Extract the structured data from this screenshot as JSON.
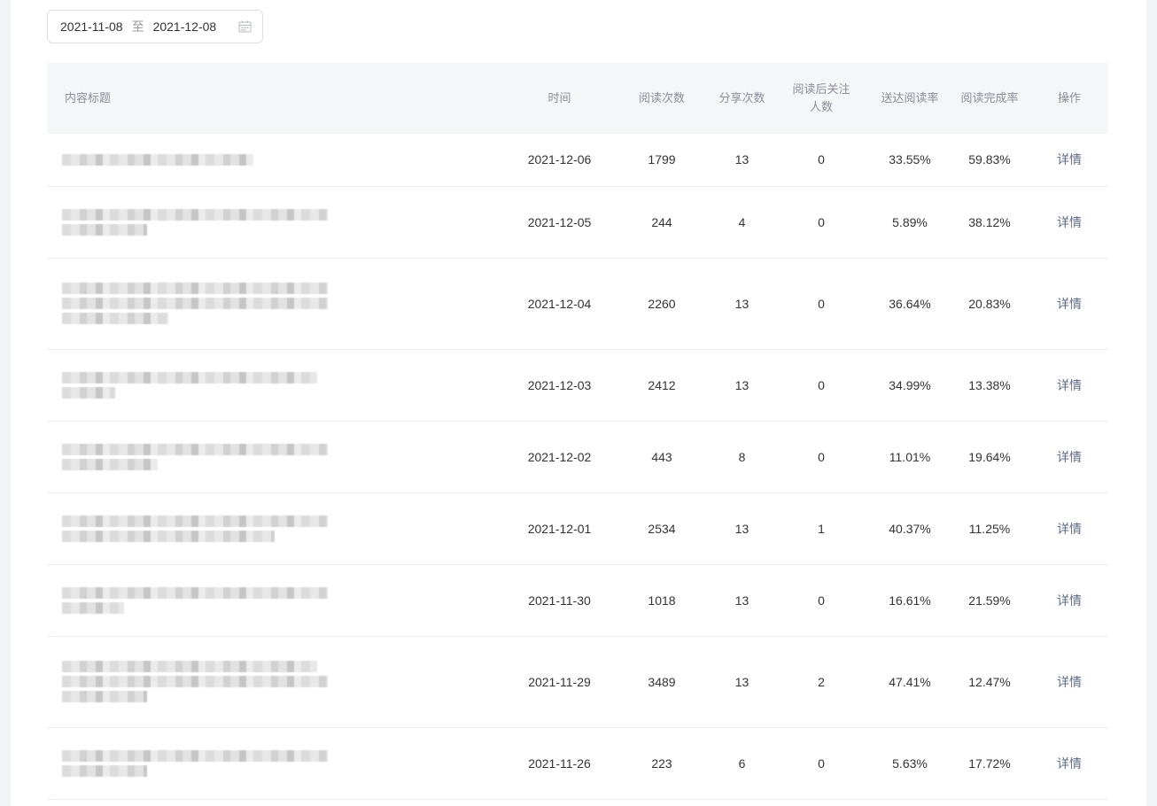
{
  "date_range": {
    "start": "2021-11-08",
    "separator": "至",
    "end": "2021-12-08",
    "icon": "calendar-icon"
  },
  "table": {
    "headers": {
      "title": "内容标题",
      "date": "时间",
      "reads": "阅读次数",
      "shares": "分享次数",
      "follows_line1": "阅读后关注",
      "follows_line2": "人数",
      "delivery_read_rate": "送达阅读率",
      "completion_rate": "阅读完成率",
      "action": "操作"
    },
    "rows": [
      {
        "date": "2021-12-06",
        "reads": "1799",
        "shares": "13",
        "follows": "0",
        "delivery_read_rate": "33.55%",
        "completion_rate": "59.83%",
        "action": "详情"
      },
      {
        "date": "2021-12-05",
        "reads": "244",
        "shares": "4",
        "follows": "0",
        "delivery_read_rate": "5.89%",
        "completion_rate": "38.12%",
        "action": "详情"
      },
      {
        "date": "2021-12-04",
        "reads": "2260",
        "shares": "13",
        "follows": "0",
        "delivery_read_rate": "36.64%",
        "completion_rate": "20.83%",
        "action": "详情"
      },
      {
        "date": "2021-12-03",
        "reads": "2412",
        "shares": "13",
        "follows": "0",
        "delivery_read_rate": "34.99%",
        "completion_rate": "13.38%",
        "action": "详情"
      },
      {
        "date": "2021-12-02",
        "reads": "443",
        "shares": "8",
        "follows": "0",
        "delivery_read_rate": "11.01%",
        "completion_rate": "19.64%",
        "action": "详情"
      },
      {
        "date": "2021-12-01",
        "reads": "2534",
        "shares": "13",
        "follows": "1",
        "delivery_read_rate": "40.37%",
        "completion_rate": "11.25%",
        "action": "详情"
      },
      {
        "date": "2021-11-30",
        "reads": "1018",
        "shares": "13",
        "follows": "0",
        "delivery_read_rate": "16.61%",
        "completion_rate": "21.59%",
        "action": "详情"
      },
      {
        "date": "2021-11-29",
        "reads": "3489",
        "shares": "13",
        "follows": "2",
        "delivery_read_rate": "47.41%",
        "completion_rate": "12.47%",
        "action": "详情"
      },
      {
        "date": "2021-11-26",
        "reads": "223",
        "shares": "6",
        "follows": "0",
        "delivery_read_rate": "5.63%",
        "completion_rate": "17.72%",
        "action": "详情"
      }
    ]
  }
}
